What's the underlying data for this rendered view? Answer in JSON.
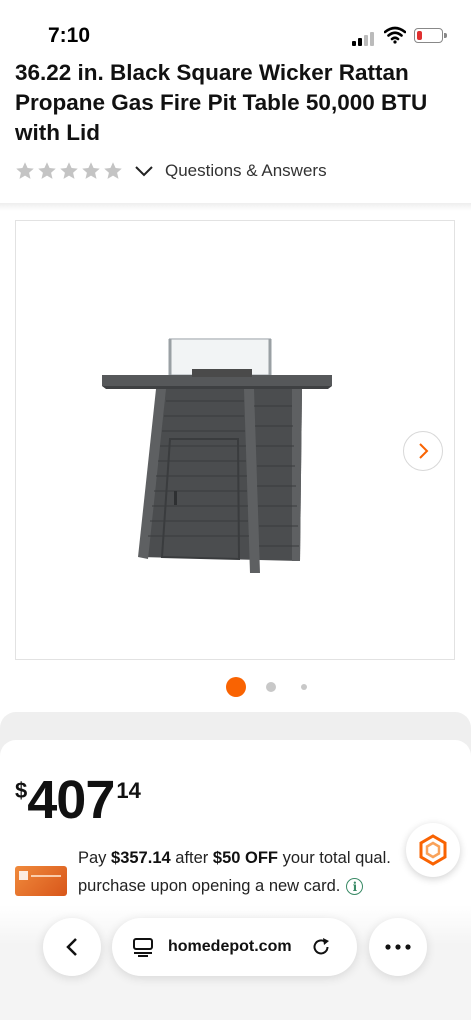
{
  "status": {
    "time": "7:10"
  },
  "product": {
    "title": "36.22 in. Black Square Wicker Rattan Propane Gas Fire Pit Table 50,000 BTU with Lid",
    "qa_link": "Questions & Answers",
    "rating_stars": 0
  },
  "price": {
    "currency": "$",
    "dollars": "407",
    "cents": "14"
  },
  "promo": {
    "pay_prefix": "Pay",
    "pay_amount": "$357.14",
    "after": "after",
    "off_amount": "$50 OFF",
    "rest": "your total qual.",
    "line2": "purchase upon opening a new card.",
    "info_icon": "i"
  },
  "browser": {
    "url": "homedepot.com"
  },
  "colors": {
    "brand_orange": "#f96302",
    "dot_inactive": "#c8c8c8",
    "star_empty": "#c4c4c4"
  }
}
